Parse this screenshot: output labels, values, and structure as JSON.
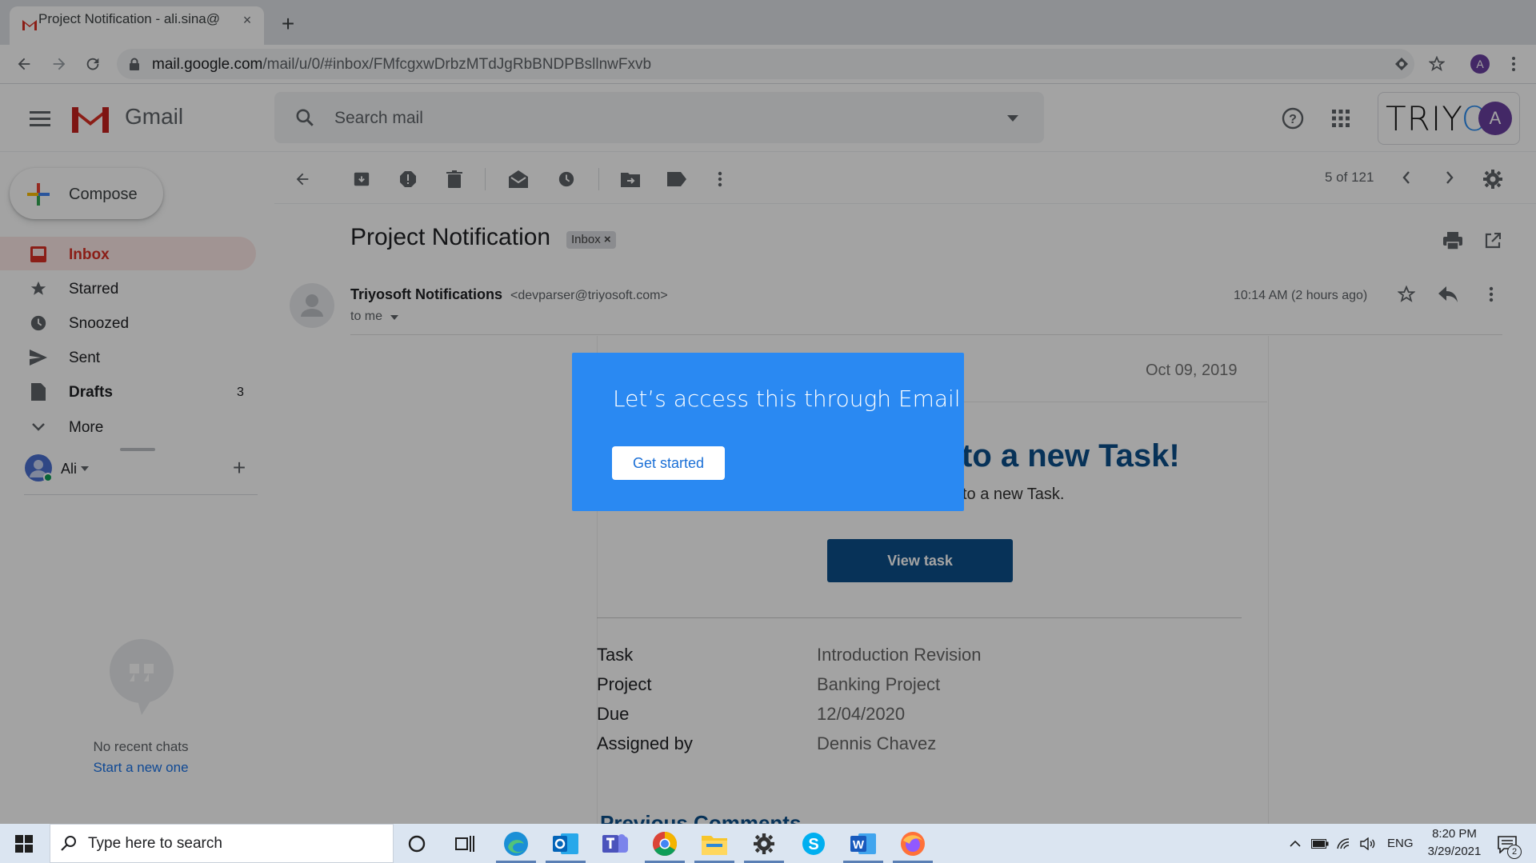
{
  "browser": {
    "tab_title": "Project Notification - ali.sina@",
    "tab_close": "×",
    "new_tab": "+",
    "url_host": "mail.google.com",
    "url_path": "/mail/u/0/#inbox/FMfcgxwDrbzMTdJgRbBNDPBsllnwFxvb",
    "profile_initial": "A"
  },
  "header": {
    "app_name": "Gmail",
    "search_placeholder": "Search mail",
    "brand_prefix": "TRIY",
    "brand_suffix": "O",
    "account_initial": "A"
  },
  "sidebar": {
    "compose_label": "Compose",
    "items": [
      {
        "label": "Inbox",
        "count": "",
        "icon": "inbox-icon"
      },
      {
        "label": "Starred",
        "count": "",
        "icon": "star-icon"
      },
      {
        "label": "Snoozed",
        "count": "",
        "icon": "clock-icon"
      },
      {
        "label": "Sent",
        "count": "",
        "icon": "send-icon"
      },
      {
        "label": "Drafts",
        "count": "3",
        "icon": "draft-icon"
      },
      {
        "label": "More",
        "count": "",
        "icon": "chevron-down-icon"
      }
    ],
    "hangouts_user": "Ali",
    "hangouts_add": "+",
    "no_chats": "No recent chats",
    "start_new": "Start a new one"
  },
  "message": {
    "pager": "5 of 121",
    "subject": "Project Notification",
    "label_chip": "Inbox",
    "chip_close": "×",
    "sender_name": "Triyosoft Notifications",
    "sender_email": "<devparser@triyosoft.com>",
    "recipient": "to me",
    "timestamp": "10:14 AM (2 hours ago)"
  },
  "email_body": {
    "date": "Oct 09, 2019",
    "headline": "to a new Task!",
    "subline": "to a new Task.",
    "button": "View task",
    "fields": [
      {
        "key": "Task",
        "value": "Introduction Revision"
      },
      {
        "key": "Project",
        "value": "Banking Project"
      },
      {
        "key": "Due",
        "value": "12/04/2020"
      },
      {
        "key": "Assigned by",
        "value": "Dennis Chavez"
      }
    ],
    "section_heading": "Previous Comments"
  },
  "modal": {
    "title": "Let’s access this through Email",
    "button": "Get started"
  },
  "taskbar": {
    "search_placeholder": "Type here to search",
    "language": "ENG",
    "time": "8:20 PM",
    "date": "3/29/2021",
    "notification_count": "2"
  },
  "colors": {
    "gmail_red": "#d93025",
    "modal_blue": "#2a89f2",
    "email_blue": "#0b4f8a",
    "link_blue": "#1a73e8"
  }
}
